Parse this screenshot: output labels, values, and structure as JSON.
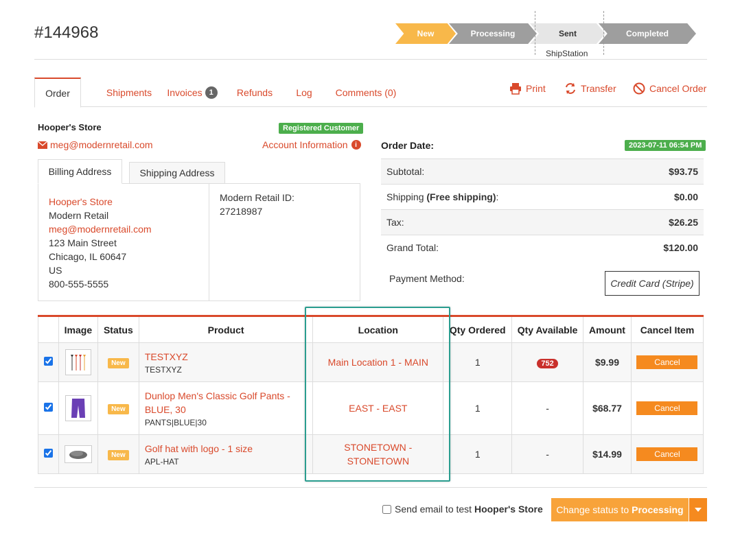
{
  "order": {
    "number": "#144968"
  },
  "pipeline": {
    "steps": [
      "New",
      "Processing",
      "Sent",
      "Completed"
    ],
    "sub_label": "ShipStation"
  },
  "tabs": {
    "order": "Order",
    "shipments": "Shipments",
    "invoices": "Invoices",
    "invoices_count": "1",
    "refunds": "Refunds",
    "log": "Log",
    "comments": "Comments (0)"
  },
  "actions": {
    "print": "Print",
    "transfer": "Transfer",
    "cancel_order": "Cancel Order"
  },
  "customer": {
    "store": "Hooper's Store",
    "badge": "Registered Customer",
    "email": "meg@modernretail.com",
    "account_info": "Account Information"
  },
  "address": {
    "billing_tab": "Billing Address",
    "shipping_tab": "Shipping Address",
    "name": "Hooper's Store",
    "company": "Modern Retail",
    "email": "meg@modernretail.com",
    "street": "123 Main Street",
    "city": "Chicago, IL 60647",
    "country": "US",
    "phone": "800-555-5555",
    "mr_id_label": "Modern Retail ID:",
    "mr_id_value": "27218987"
  },
  "totals": {
    "order_date_label": "Order Date:",
    "order_date": "2023-07-11 06:54 PM",
    "subtotal_label": "Subtotal:",
    "subtotal": "$93.75",
    "shipping_label": "Shipping",
    "shipping_note": "(Free shipping)",
    "shipping_colon": ":",
    "shipping": "$0.00",
    "tax_label": "Tax:",
    "tax": "$26.25",
    "grand_label": "Grand Total:",
    "grand": "$120.00",
    "payment_label": "Payment Method:",
    "payment_method": "Credit Card (Stripe)"
  },
  "items": {
    "headers": [
      "Image",
      "Status",
      "Product",
      "Location",
      "Qty Ordered",
      "Qty Available",
      "Amount",
      "Cancel Item"
    ],
    "rows": [
      {
        "status": "New",
        "name": "TESTXYZ",
        "sku": "TESTXYZ",
        "location": "Main Location 1 - MAIN",
        "qty_ordered": "1",
        "qty_available": "752",
        "amount": "$9.99",
        "cancel": "Cancel"
      },
      {
        "status": "New",
        "name": "Dunlop Men's Classic Golf Pants - BLUE, 30",
        "sku": "PANTS|BLUE|30",
        "location": "EAST - EAST",
        "qty_ordered": "1",
        "qty_available": "-",
        "amount": "$68.77",
        "cancel": "Cancel"
      },
      {
        "status": "New",
        "name": "Golf hat with logo - 1 size",
        "sku": "APL-HAT",
        "location": "STONETOWN - STONETOWN",
        "qty_ordered": "1",
        "qty_available": "-",
        "amount": "$14.99",
        "cancel": "Cancel"
      }
    ]
  },
  "footer": {
    "send_email_prefix": "Send email to test",
    "send_email_store": "Hooper's Store",
    "change_status_prefix": "Change status to",
    "change_status_target": "Processing"
  },
  "colors": {
    "accent": "#d9492b",
    "new": "#f8b84a",
    "orange": "#f58a1f",
    "success": "#4cae4c",
    "highlight": "#2a9d8f"
  }
}
